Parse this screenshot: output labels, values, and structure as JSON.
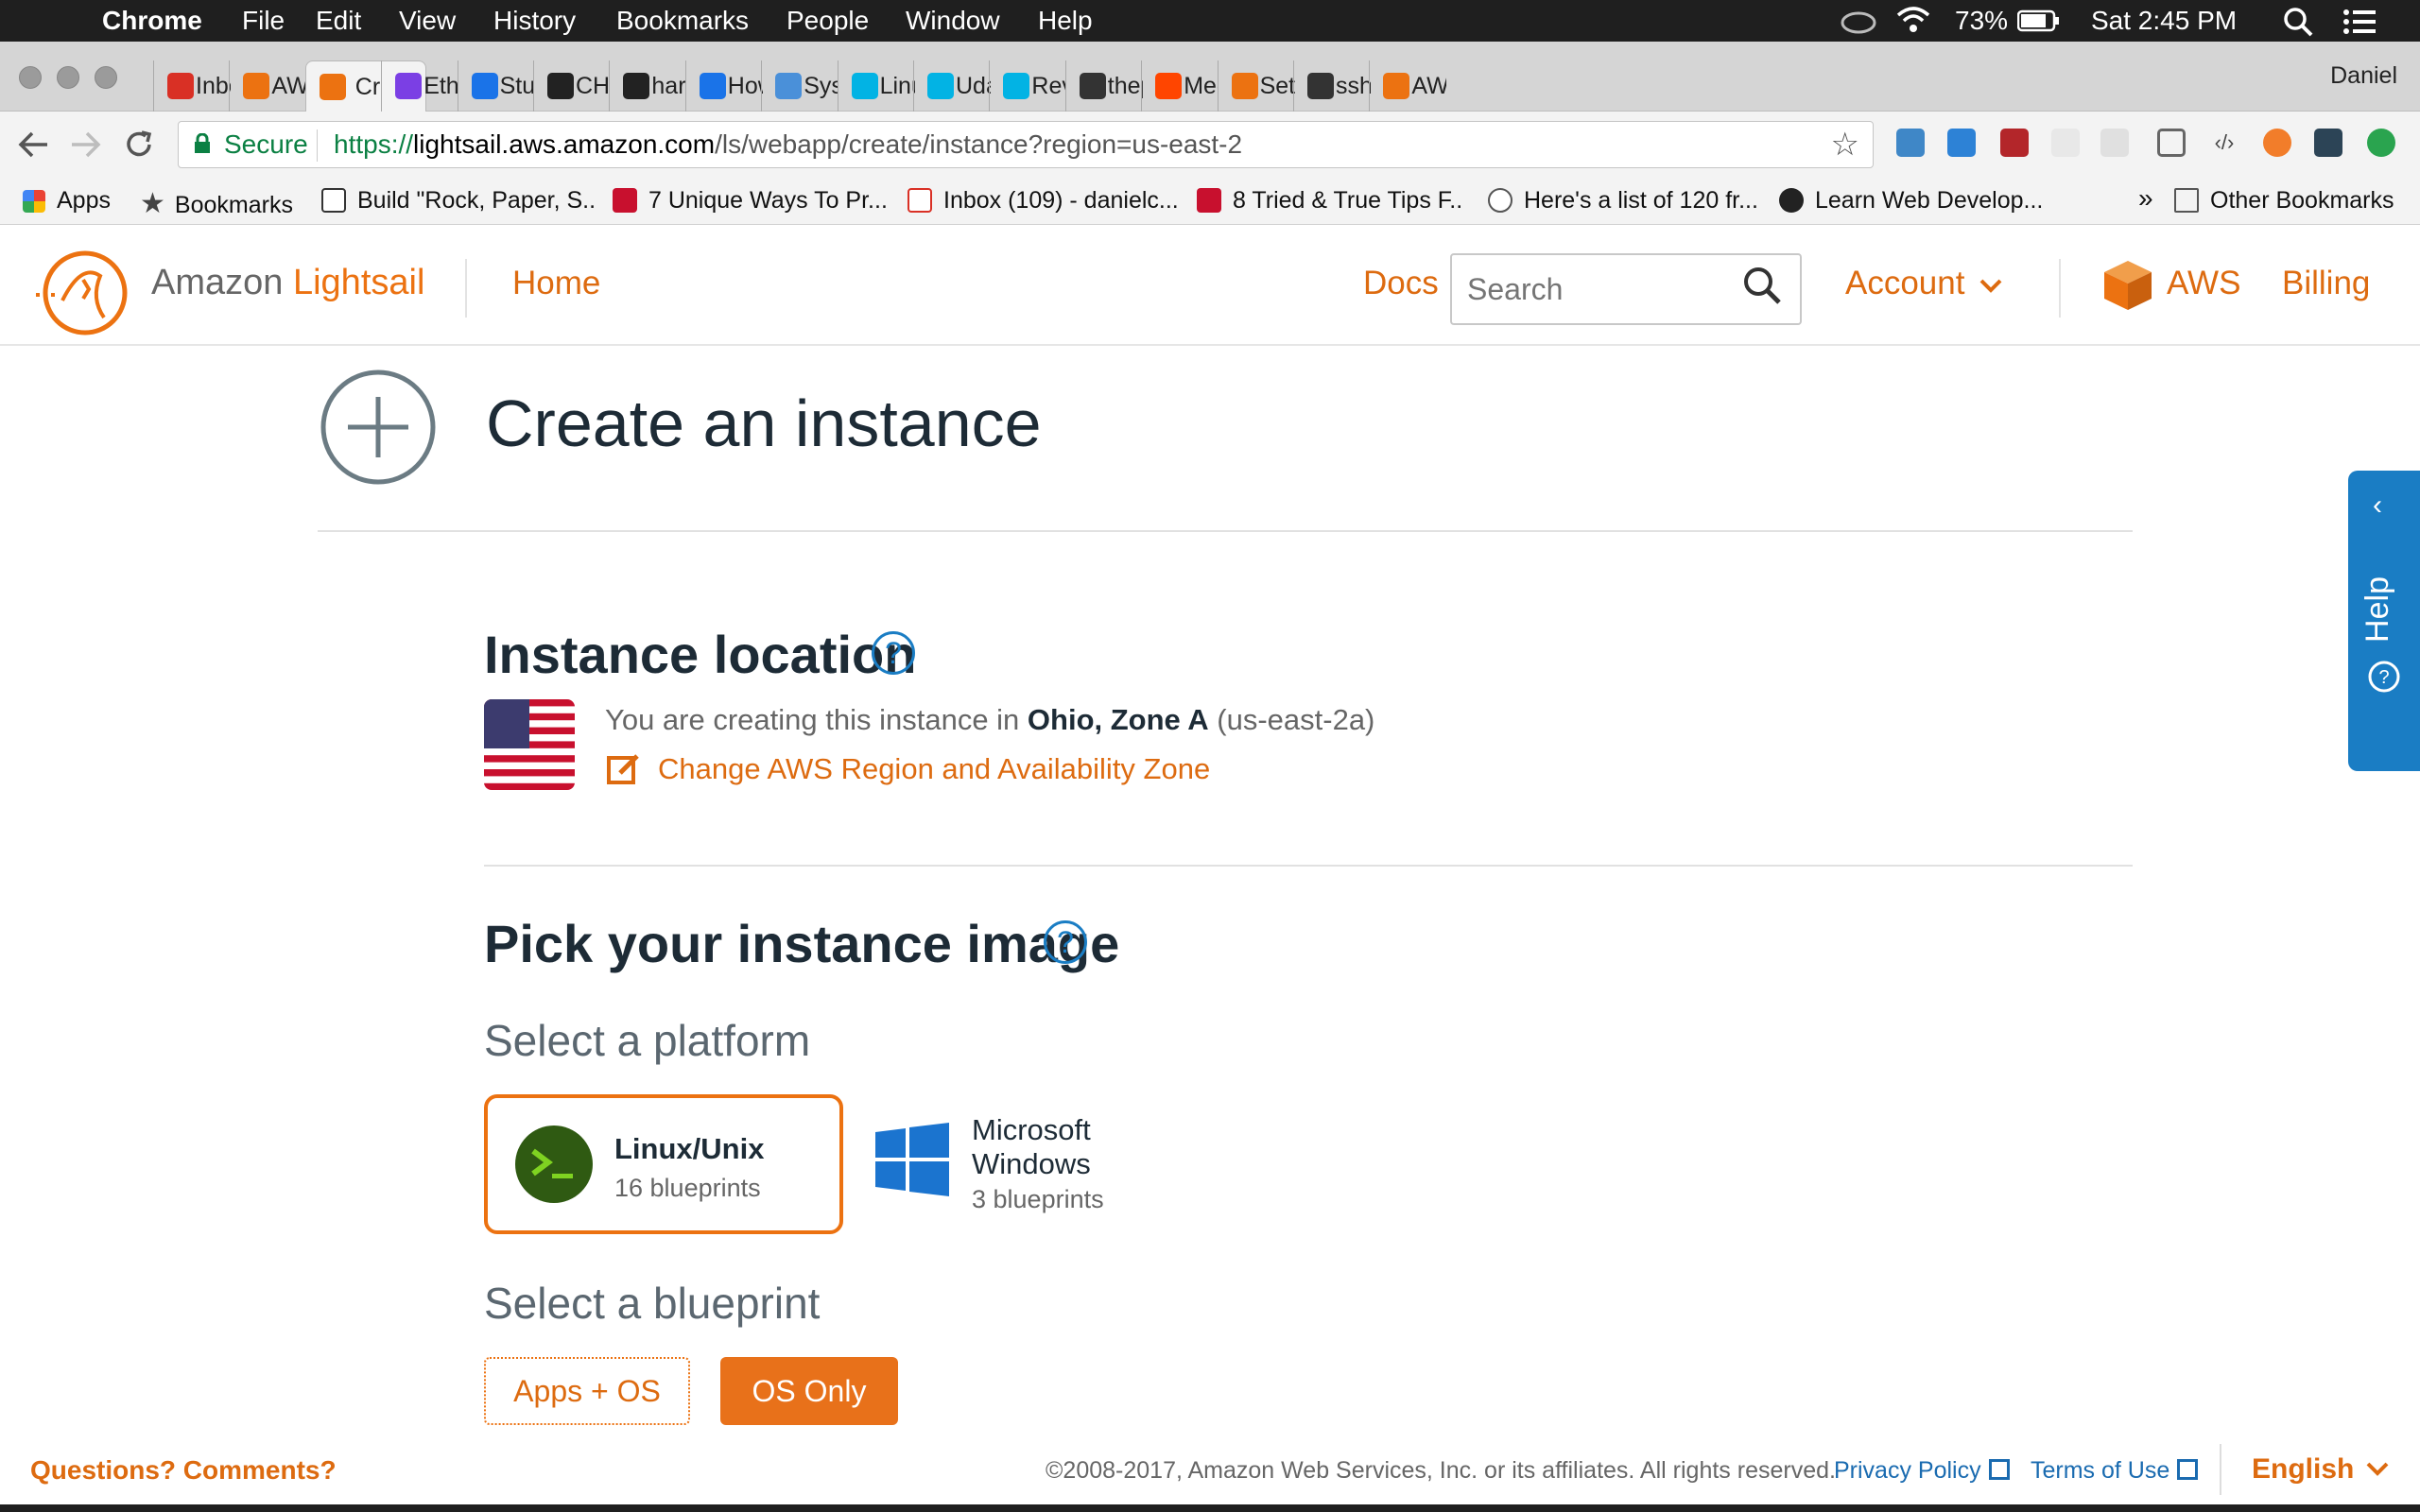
{
  "menubar": {
    "app": "Chrome",
    "items": [
      "File",
      "Edit",
      "View",
      "History",
      "Bookmarks",
      "People",
      "Window",
      "Help"
    ],
    "battery": "73%",
    "clock": "Sat 2:45 PM"
  },
  "tabs": [
    {
      "label": "Inbo",
      "color": "#d93025"
    },
    {
      "label": "AWS",
      "color": "#ec7211"
    },
    {
      "label": "Cr",
      "color": "#ec7211",
      "active": true
    },
    {
      "label": "Ethe",
      "color": "#7b3fe4"
    },
    {
      "label": "Stun",
      "color": "#1a73e8"
    },
    {
      "label": "CHB",
      "color": "#222222"
    },
    {
      "label": "haru",
      "color": "#222222"
    },
    {
      "label": "How",
      "color": "#1a73e8"
    },
    {
      "label": "Syst",
      "color": "#4a90d9"
    },
    {
      "label": "Linu",
      "color": "#02b3e4"
    },
    {
      "label": "Udac",
      "color": "#02b3e4"
    },
    {
      "label": "Revie",
      "color": "#02b3e4"
    },
    {
      "label": "thep",
      "color": "#333333"
    },
    {
      "label": "Meg",
      "color": "#ff4500"
    },
    {
      "label": "Set u",
      "color": "#ec7211"
    },
    {
      "label": "sshd",
      "color": "#333333"
    },
    {
      "label": "AWS",
      "color": "#ec7211"
    }
  ],
  "profile": "Daniel",
  "omnibox": {
    "secure": "Secure",
    "scheme": "https://",
    "host": "lightsail.aws.amazon.com",
    "path": "/ls/webapp/create/instance?region=us-east-2"
  },
  "bookmarks": [
    {
      "label": "Apps",
      "icon": "apps-grid-icon"
    },
    {
      "label": "Bookmarks",
      "icon": "star-icon"
    },
    {
      "label": "Build \"Rock, Paper, S..",
      "icon": "page-icon"
    },
    {
      "label": "7 Unique Ways To Pr...",
      "icon": "red-square-icon"
    },
    {
      "label": "Inbox (109) - danielc...",
      "icon": "gmail-icon"
    },
    {
      "label": "8 Tried & True Tips F..",
      "icon": "red-square-icon"
    },
    {
      "label": "Here's a list of 120 fr...",
      "icon": "reddit-icon"
    },
    {
      "label": "Learn Web Develop...",
      "icon": "freecodecamp-icon"
    }
  ],
  "bookmarks_more": "»",
  "bookmarks_other": "Other Bookmarks",
  "header": {
    "brand_prefix": "Amazon",
    "brand_name": "Lightsail",
    "home": "Home",
    "docs": "Docs",
    "search_placeholder": "Search",
    "account": "Account",
    "aws": "AWS",
    "billing": "Billing"
  },
  "help_tab": {
    "chevron": "‹",
    "label": "Help"
  },
  "main": {
    "title": "Create an instance",
    "location": {
      "title": "Instance location",
      "help": "?",
      "text_prefix": "You are creating this instance in ",
      "zone": "Ohio, Zone A",
      "zone_code": " (us-east-2a)",
      "change_link": "Change AWS Region and Availability Zone"
    },
    "image": {
      "title": "Pick your instance image",
      "help": "?",
      "platform_title": "Select a platform",
      "platforms": [
        {
          "name": "Linux/Unix",
          "count": "16 blueprints",
          "selected": true
        },
        {
          "name_line1": "Microsoft",
          "name_line2": "Windows",
          "count": "3 blueprints",
          "selected": false
        }
      ],
      "blueprint_title": "Select a blueprint",
      "blueprint_buttons": [
        {
          "label": "Apps + OS",
          "selected": false
        },
        {
          "label": "OS Only",
          "selected": true
        }
      ]
    }
  },
  "footer": {
    "questions": "Questions? Comments?",
    "copyright": "©2008-2017, Amazon Web Services, Inc. or its affiliates. All rights reserved.",
    "privacy": "Privacy Policy",
    "terms": "Terms of Use",
    "language": "English"
  },
  "colors": {
    "brand_orange": "#ec7211",
    "link_blue": "#1a7dc4",
    "text_dark": "#1d2b36"
  }
}
